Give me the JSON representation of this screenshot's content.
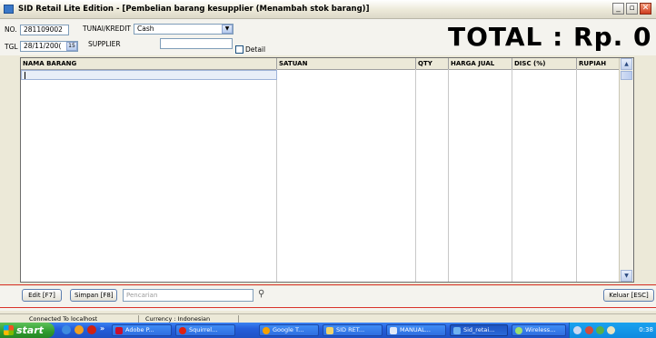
{
  "window": {
    "title": "SID Retail Lite Edition - [Pembelian barang kesupplier (Menambah stok barang)]",
    "min_label": "_",
    "max_label": "▫",
    "close_label": "✕"
  },
  "header": {
    "no_label": "NO.",
    "no_value": "281109002",
    "payment_label": "TUNAI/KREDIT",
    "payment_value": "Cash",
    "combo_arrow": "▼",
    "date_label": "TGL",
    "date_value": "28/11/200(",
    "date_picker_glyph": "15",
    "supplier_label": "SUPPLIER",
    "supplier_value": "",
    "detail_label": "Detail",
    "total_text": "TOTAL : Rp. 0"
  },
  "grid": {
    "columns": [
      "NAMA BARANG",
      "SATUAN",
      "QTY",
      "HARGA JUAL",
      "DISC (%)",
      "RUPIAH"
    ],
    "rows": [],
    "scroll_up": "▲",
    "scroll_down": "▼"
  },
  "footer": {
    "edit_label": "Edit [F7]",
    "save_label": "Simpan [F8]",
    "search_placeholder": "Pencarian",
    "search_glyph": "⚲",
    "exit_label": "Keluar [ESC]"
  },
  "status": {
    "connection": "Connected To localhost",
    "currency": "Currency : Indonesian"
  },
  "taskbar": {
    "start_label": "start",
    "overflow": "»",
    "items": [
      "Adobe P...",
      "Squirrel...",
      "Google T...",
      "SID RET...",
      "MANUAL...",
      "Sid_retai...",
      "Wireless..."
    ],
    "clock": "0:38"
  },
  "colors": {
    "accent_red": "#d8322a",
    "taskbar_blue": "#245edb",
    "start_green": "#2f9b2e"
  }
}
